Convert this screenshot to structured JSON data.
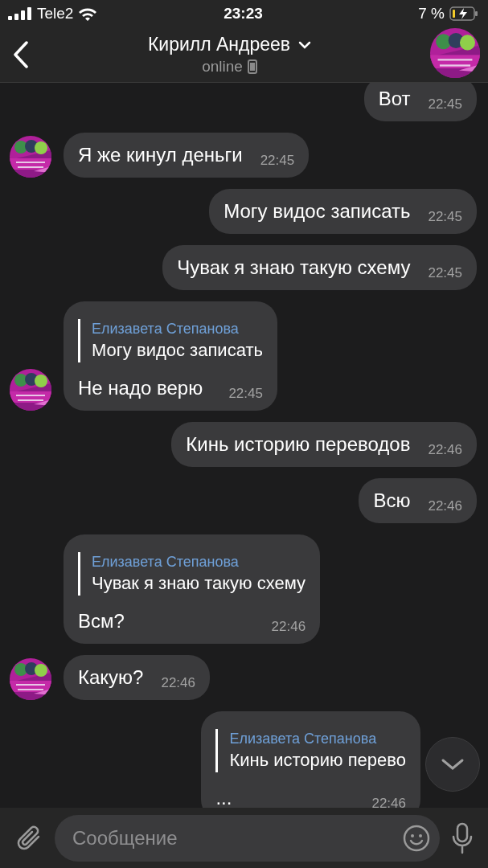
{
  "status_bar": {
    "carrier": "Tele2",
    "time": "23:23",
    "battery": "7 %",
    "charging": true
  },
  "header": {
    "title": "Кирилл Андреев",
    "status": "online"
  },
  "messages": [
    {
      "kind": "outgoing",
      "text": "Вот",
      "time": "22:45"
    },
    {
      "kind": "incoming",
      "avatar": true,
      "text": "Я же кинул деньги",
      "time": "22:45"
    },
    {
      "kind": "outgoing",
      "text": "Могу видос записать",
      "time": "22:45"
    },
    {
      "kind": "outgoing",
      "text": "Чувак я знаю такую схему",
      "time": "22:45"
    },
    {
      "kind": "incoming",
      "avatar": true,
      "reply": {
        "author": "Елизавета Степанова",
        "text": "Могу видос записать"
      },
      "text": "Не надо верю",
      "time": "22:45"
    },
    {
      "kind": "outgoing",
      "text": "Кинь историю переводов",
      "time": "22:46"
    },
    {
      "kind": "outgoing",
      "text": "Всю",
      "time": "22:46"
    },
    {
      "kind": "incoming",
      "avatar": false,
      "reply": {
        "author": "Елизавета Степанова",
        "text": "Чувак я знаю такую схему"
      },
      "text": "Всм?",
      "time": "22:46"
    },
    {
      "kind": "incoming",
      "avatar": true,
      "text": "Какую?",
      "time": "22:46"
    },
    {
      "kind": "outgoing",
      "reply": {
        "author": "Елизавета Степанова",
        "text": "Кинь историю перево"
      },
      "text": "...",
      "time": "22:46"
    }
  ],
  "composer": {
    "placeholder": "Сообщение"
  }
}
